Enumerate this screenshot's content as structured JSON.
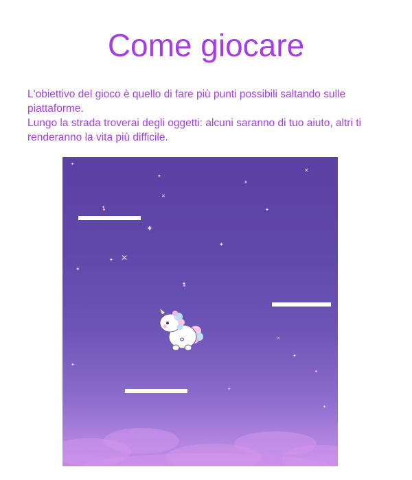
{
  "page": {
    "title": "Come giocare",
    "instructions": [
      "L'obiettivo del gioco è quello di fare più punti possibili saltando sulle piattaforme.",
      "Lungo la strada troverai degli oggetti: alcuni saranno di tuo aiuto, altri ti renderanno la vita più difficile."
    ]
  },
  "game": {
    "player": "unicorn",
    "platform_count": 3,
    "colors": {
      "text_accent": "#a63ce6",
      "sky_top": "#5a41a3",
      "sky_bottom": "#c38be6",
      "platform": "#ffffff"
    }
  }
}
